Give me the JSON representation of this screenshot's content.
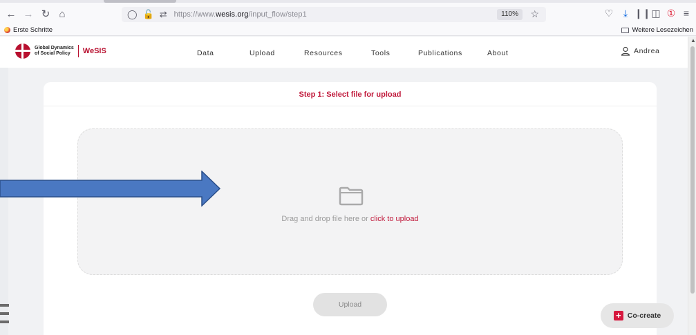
{
  "browser": {
    "url_prefix": "https://www.",
    "url_domain": "wesis.org",
    "url_path": "/input_flow/step1",
    "zoom": "110%",
    "bookmarks": {
      "left_label": "Erste Schritte",
      "right_label": "Weitere Lesezeichen"
    }
  },
  "site": {
    "logo_line1": "Global Dynamics",
    "logo_line2": "of Social Policy",
    "logo_brand": "WeSIS",
    "menu": [
      "Data",
      "Upload",
      "Resources",
      "Tools",
      "Publications",
      "About"
    ],
    "user_name": "Andrea"
  },
  "card": {
    "title": "Step 1: Select file for upload",
    "dropzone_text": "Drag and drop file here or ",
    "dropzone_link": "click to upload",
    "upload_button": "Upload"
  },
  "cocreate": {
    "label": "Co-create"
  },
  "colors": {
    "accent": "#c0183a",
    "arrow_fill": "#4a78c2",
    "arrow_stroke": "#2b4f8a"
  }
}
